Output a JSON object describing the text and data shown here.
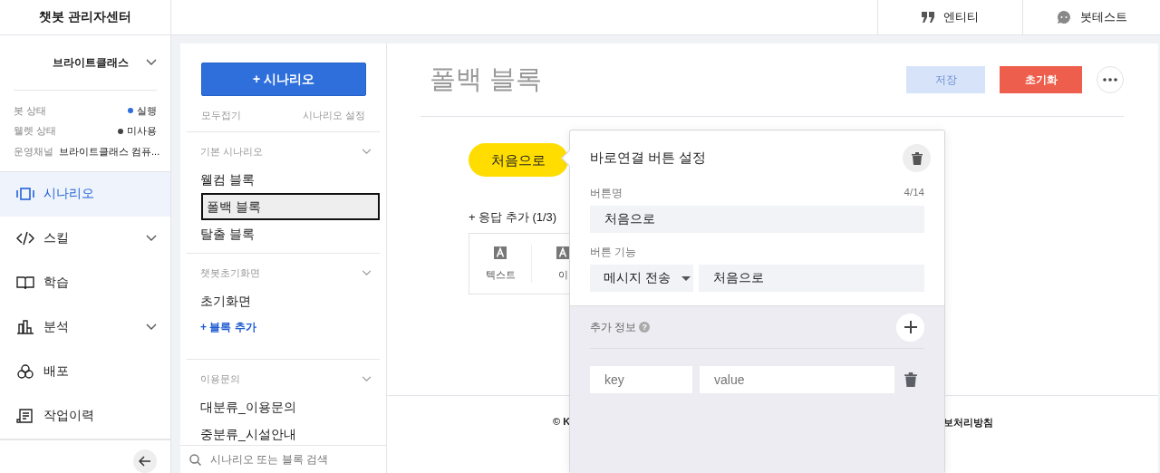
{
  "app_title": "챗봇 관리자센터",
  "header_tabs": [
    {
      "label": "엔티티",
      "kind": "quote"
    },
    {
      "label": "봇테스트",
      "kind": "chat"
    }
  ],
  "bot_selector": {
    "label": "브라이트클래스"
  },
  "statuses": [
    {
      "label": "봇 상태",
      "value": "실행",
      "color": "#2f6fdc"
    },
    {
      "label": "웰렛 상태",
      "value": "미사용",
      "color": "#444444"
    },
    {
      "label": "운영채널",
      "value": "브라이트클래스 컴퓨..."
    }
  ],
  "nav": [
    {
      "label": "시나리오",
      "kind": "scenario",
      "selected": true,
      "expandable": false
    },
    {
      "label": "스킬",
      "kind": "code",
      "selected": false,
      "expandable": true
    },
    {
      "label": "학습",
      "kind": "book",
      "selected": false,
      "expandable": false
    },
    {
      "label": "분석",
      "kind": "chart",
      "selected": false,
      "expandable": true
    },
    {
      "label": "배포",
      "kind": "deploy",
      "selected": false,
      "expandable": false
    },
    {
      "label": "작업이력",
      "kind": "history",
      "selected": false,
      "expandable": false
    }
  ],
  "scenario_panel": {
    "add_button": "+ 시나리오",
    "collapse_all": "모두접기",
    "settings": "시나리오 설정",
    "groups": [
      {
        "title": "기본 시나리오",
        "items": [
          {
            "label": "웰컴 블록",
            "selected": false
          },
          {
            "label": "폴백 블록",
            "selected": true
          },
          {
            "label": "탈출 블록",
            "selected": false
          }
        ]
      },
      {
        "title": "챗봇초기화면",
        "items": [
          {
            "label": "초기화면",
            "selected": false
          }
        ],
        "add_link": "+ 블록 추가"
      },
      {
        "title": "이용문의",
        "items": [
          {
            "label": "대분류_이용문의",
            "selected": false
          },
          {
            "label": "중분류_시설안내",
            "selected": false
          }
        ]
      }
    ],
    "search": {
      "placeholder": "시나리오 또는 블록 검색"
    }
  },
  "editor": {
    "title": "폴백 블록",
    "save": {
      "label": "저장",
      "disabled": true
    },
    "reset": "초기화",
    "quick_reply": "처음으로",
    "add_response": "+ 응답 추가 (1/3)",
    "response_types": [
      {
        "label": "텍스트"
      },
      {
        "label": "이"
      }
    ]
  },
  "footer": {
    "left": "© K",
    "right": "보처리방침"
  },
  "popup": {
    "title": "바로연결 버튼 설정",
    "name_label": "버튼명",
    "name_count": "4/14",
    "name_value": "처음으로",
    "function_label": "버튼 기능",
    "function_select": "메시지 전송",
    "function_value": "처음으로",
    "extra_label": "추가 정보",
    "extra_help": "?",
    "key_placeholder": "key",
    "value_placeholder": "value"
  }
}
